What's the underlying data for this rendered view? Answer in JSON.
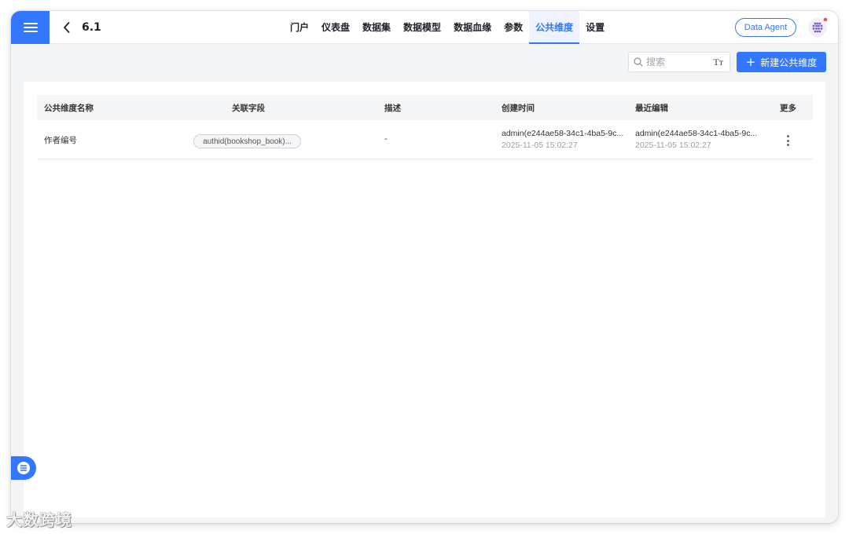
{
  "header": {
    "title": "6.1",
    "tabs": [
      {
        "label": "门户",
        "active": false
      },
      {
        "label": "仪表盘",
        "active": false
      },
      {
        "label": "数据集",
        "active": false
      },
      {
        "label": "数据模型",
        "active": false
      },
      {
        "label": "数据血缘",
        "active": false
      },
      {
        "label": "参数",
        "active": false
      },
      {
        "label": "公共维度",
        "active": true
      },
      {
        "label": "设置",
        "active": false
      }
    ],
    "agent_button": "Data Agent"
  },
  "toolbar": {
    "search_placeholder": "搜索",
    "font_toggle": "Tт",
    "new_button": "新建公共维度"
  },
  "table": {
    "columns": [
      "公共维度名称",
      "关联字段",
      "描述",
      "创建时间",
      "最近编辑",
      "更多"
    ],
    "rows": [
      {
        "name": "作者编号",
        "field": "authid(bookshop_book)...",
        "description": "-",
        "created_by": "admin(e244ae58-34c1-4ba5-9c...",
        "created_at": "2025-11-05 15:02:27",
        "edited_by": "admin(e244ae58-34c1-4ba5-9c...",
        "edited_at": "2025-11-05 15:02:27"
      }
    ]
  },
  "watermark": "大数跨境",
  "colors": {
    "accent": "#3377ff",
    "background": "#f3f4f6",
    "header_bg": "#f4f5f7"
  }
}
